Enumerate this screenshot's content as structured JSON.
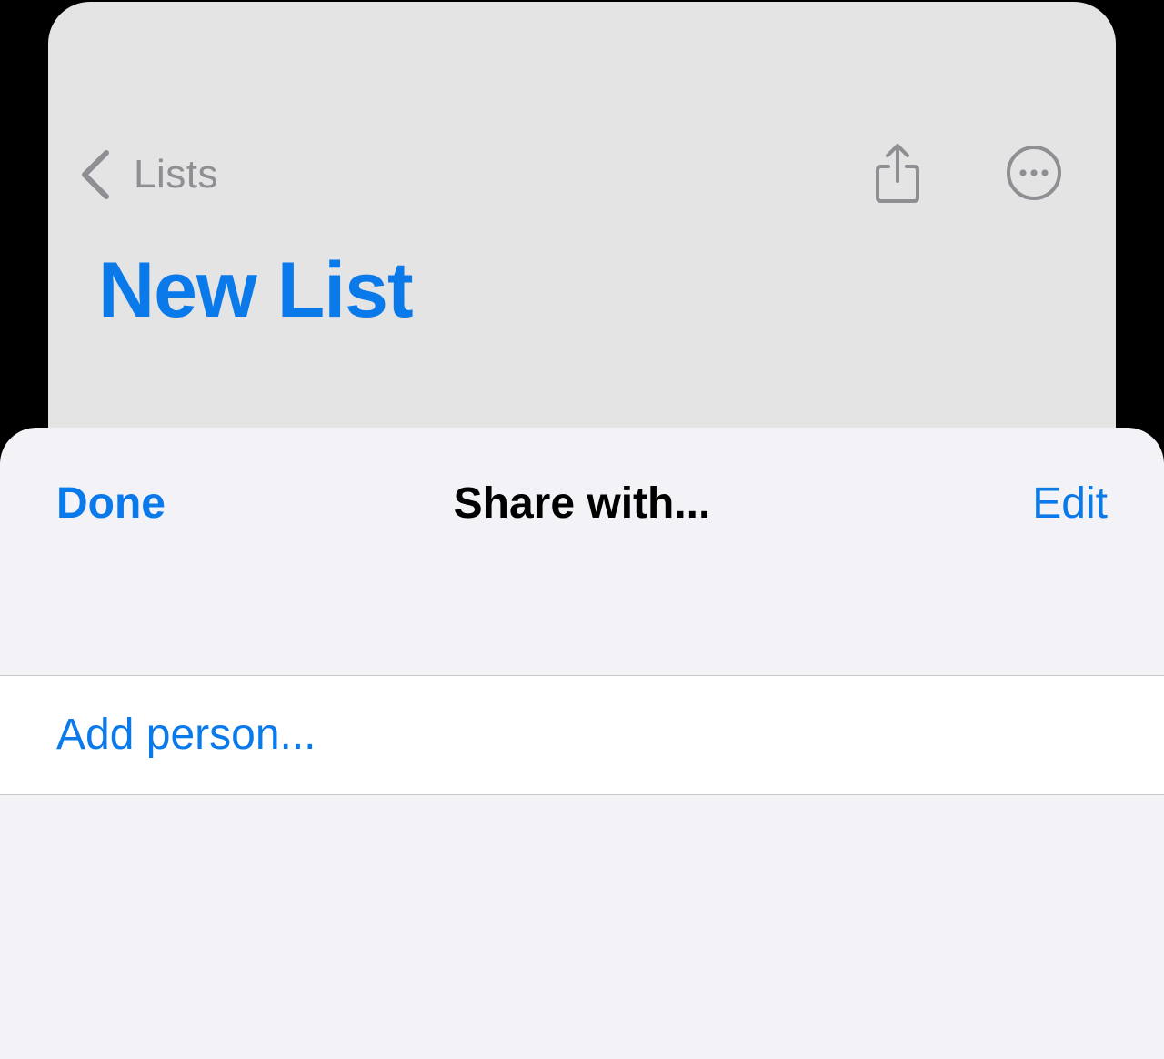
{
  "background_screen": {
    "back_label": "Lists",
    "title": "New List",
    "icons": {
      "back": "chevron-left-icon",
      "share": "share-icon",
      "more": "ellipsis-circle-icon"
    }
  },
  "share_sheet": {
    "done_label": "Done",
    "title": "Share with...",
    "edit_label": "Edit",
    "add_person_label": "Add person..."
  },
  "colors": {
    "accent": "#0a79ea",
    "dimmed_gray": "#8e8e93",
    "card_background": "#e4e4e5",
    "sheet_background": "#f2f2f7",
    "row_background": "#ffffff"
  }
}
